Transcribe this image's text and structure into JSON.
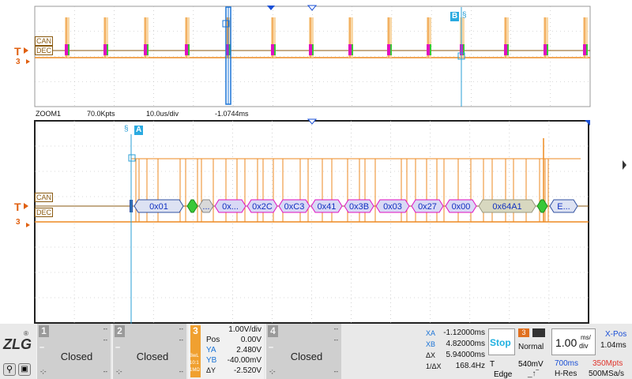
{
  "colors": {
    "signal": "#ee8a20",
    "signal_band": "#f8d7a6",
    "decode_fill": "#d9d9f5",
    "decode_border": "#e010c0",
    "decode_text": "#1030c0",
    "cursor": "#2a9fd6",
    "marker": "#1a73d6",
    "data_green": "#38c838",
    "grid": "#b5b5b5"
  },
  "overview": {
    "can_label": "CAN",
    "dec_label": "DEC",
    "trigger_level": "3",
    "cursor_b_label": "B"
  },
  "zoom_bar": {
    "name": "ZOOM1",
    "points": "70.0Kpts",
    "timebase": "10.0us/div",
    "offset": "-1.0744ms"
  },
  "zoom": {
    "can_label": "CAN",
    "dec_label": "DEC",
    "trigger_level": "3",
    "cursor_a_label": "A",
    "frames": [
      {
        "text": "0x01",
        "kind": "id"
      },
      {
        "text": "",
        "kind": "green"
      },
      {
        "text": "...",
        "kind": "gray"
      },
      {
        "text": "0x...",
        "kind": "byte"
      },
      {
        "text": "0x2C",
        "kind": "byte"
      },
      {
        "text": "0xC3",
        "kind": "byte"
      },
      {
        "text": "0x41",
        "kind": "byte"
      },
      {
        "text": "0x3B",
        "kind": "byte"
      },
      {
        "text": "0x03",
        "kind": "byte"
      },
      {
        "text": "0x27",
        "kind": "byte"
      },
      {
        "text": "0x00",
        "kind": "byte"
      },
      {
        "text": "0x64A1",
        "kind": "crc"
      },
      {
        "text": "",
        "kind": "green"
      },
      {
        "text": "E...",
        "kind": "id"
      }
    ]
  },
  "logo": {
    "text": "ZLG",
    "reg": "®"
  },
  "channels": [
    {
      "num": "1",
      "scale": "--",
      "offset": "--",
      "status": "Closed",
      "foot_left": "-;-",
      "foot_right": "--"
    },
    {
      "num": "2",
      "scale": "--",
      "offset": "--",
      "status": "Closed",
      "foot_left": "-;-",
      "foot_right": "--"
    },
    {
      "num": "3",
      "scale": "1.00V/div",
      "pos_label": "Pos",
      "pos": "0.00V",
      "ya_label": "YA",
      "ya": "2.480V",
      "yb_label": "YB",
      "yb": "-40.00mV",
      "dy_label": "ΔY",
      "dy": "-2.520V",
      "bw": "BwL",
      "ratio": "10:1",
      "imp": "1MΩ"
    },
    {
      "num": "4",
      "scale": "--",
      "offset": "--",
      "status": "Closed",
      "foot_left": "-;-",
      "foot_right": "--"
    }
  ],
  "measure": {
    "xa_label": "XA",
    "xa": "-1.12000ms",
    "xb_label": "XB",
    "xb": "4.82000ms",
    "dx_label": "ΔX",
    "dx": "5.94000ms",
    "inv_label": "1/ΔX",
    "inv": "168.4Hz"
  },
  "run_state": "Stop",
  "trigger": {
    "channel": "3",
    "mode": "Normal",
    "type_label": "T",
    "level": "540mV",
    "edge_label": "Edge"
  },
  "timebase": {
    "value": "1.00",
    "unit": "ms/",
    "unit2": "div",
    "xpos_label": "X-Pos",
    "xpos": "1.04ms",
    "window": "700ms",
    "memory": "350Mpts",
    "acq": "H-Res",
    "rate": "500MSa/s"
  }
}
